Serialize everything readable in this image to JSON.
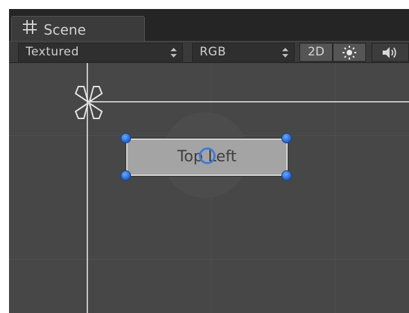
{
  "tab": {
    "title": "Scene",
    "icon": "hash-icon"
  },
  "toolbar": {
    "draw_mode": "Textured",
    "render_mode": "RGB",
    "toggle_2d": "2D",
    "lighting_icon": "sun-icon",
    "audio_icon": "speaker-icon"
  },
  "scene": {
    "element_label": "Top Left",
    "handle_color": "#2f78e0",
    "axis_color": "#c8c8c8",
    "background": "#474747"
  }
}
